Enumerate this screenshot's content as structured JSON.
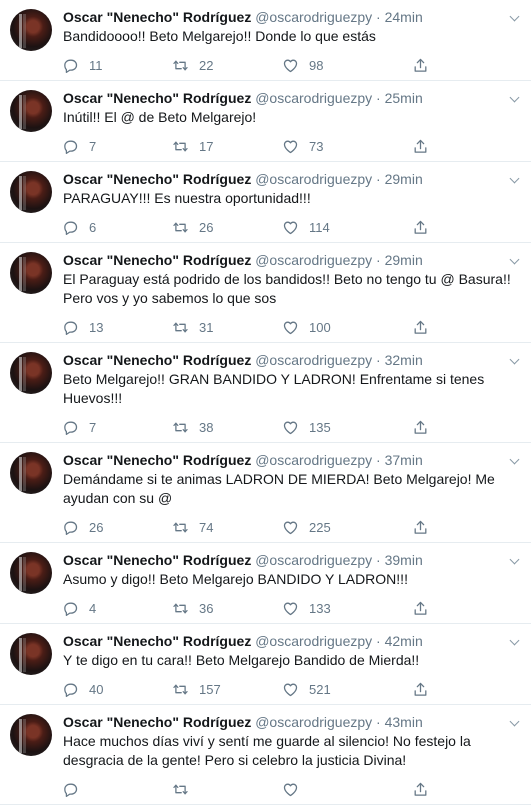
{
  "user": {
    "name": "Oscar \"Nenecho\" Rodríguez",
    "handle": "@oscarodriguezpy"
  },
  "icons": {
    "reply": "reply-icon",
    "retweet": "retweet-icon",
    "like": "heart-icon",
    "share": "share-icon",
    "more": "chevron-down-icon"
  },
  "tweets": [
    {
      "time": "24min",
      "text": "Bandidoooo!! Beto Melgarejo!! Donde lo que estás",
      "replies": "11",
      "retweets": "22",
      "likes": "98"
    },
    {
      "time": "25min",
      "text": "Inútil!! El @ de Beto Melgarejo!",
      "replies": "7",
      "retweets": "17",
      "likes": "73"
    },
    {
      "time": "29min",
      "text": "PARAGUAY!!! Es nuestra oportunidad!!!",
      "replies": "6",
      "retweets": "26",
      "likes": "114"
    },
    {
      "time": "29min",
      "text": "El Paraguay está podrido de los bandidos!! Beto no tengo tu @ Basura!! Pero vos y yo sabemos lo que sos",
      "replies": "13",
      "retweets": "31",
      "likes": "100"
    },
    {
      "time": "32min",
      "text": "Beto Melgarejo!! GRAN BANDIDO Y LADRON! Enfrentame si tenes Huevos!!!",
      "replies": "7",
      "retweets": "38",
      "likes": "135"
    },
    {
      "time": "37min",
      "text": "Demándame si te animas LADRON DE MIERDA! Beto Melgarejo! Me ayudan con su @",
      "replies": "26",
      "retweets": "74",
      "likes": "225"
    },
    {
      "time": "39min",
      "text": "Asumo y digo!! Beto Melgarejo BANDIDO Y LADRON!!!",
      "replies": "4",
      "retweets": "36",
      "likes": "133"
    },
    {
      "time": "42min",
      "text": "Y te digo en tu cara!! Beto Melgarejo Bandido de Mierda!!",
      "replies": "40",
      "retweets": "157",
      "likes": "521"
    },
    {
      "time": "43min",
      "text": "Hace muchos días viví y sentí me guarde al silencio! No festejo la desgracia de la gente! Pero si celebro la justicia Divina!",
      "replies": "",
      "retweets": "",
      "likes": ""
    }
  ]
}
